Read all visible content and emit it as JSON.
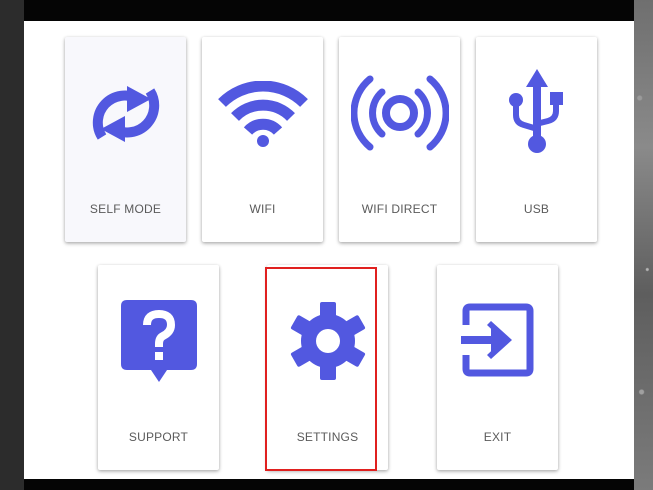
{
  "accent_color": "#5258e0",
  "highlight_color": "#e0201f",
  "menu": {
    "self_mode": {
      "label": "SELF MODE",
      "icon": "sync-icon"
    },
    "wifi": {
      "label": "WIFI",
      "icon": "wifi-icon"
    },
    "wifi_direct": {
      "label": "WIFI DIRECT",
      "icon": "broadcast-icon"
    },
    "usb": {
      "label": "USB",
      "icon": "usb-icon"
    },
    "support": {
      "label": "SUPPORT",
      "icon": "help-icon"
    },
    "settings": {
      "label": "SETTINGS",
      "icon": "gear-icon"
    },
    "exit": {
      "label": "EXIT",
      "icon": "exit-icon"
    }
  }
}
